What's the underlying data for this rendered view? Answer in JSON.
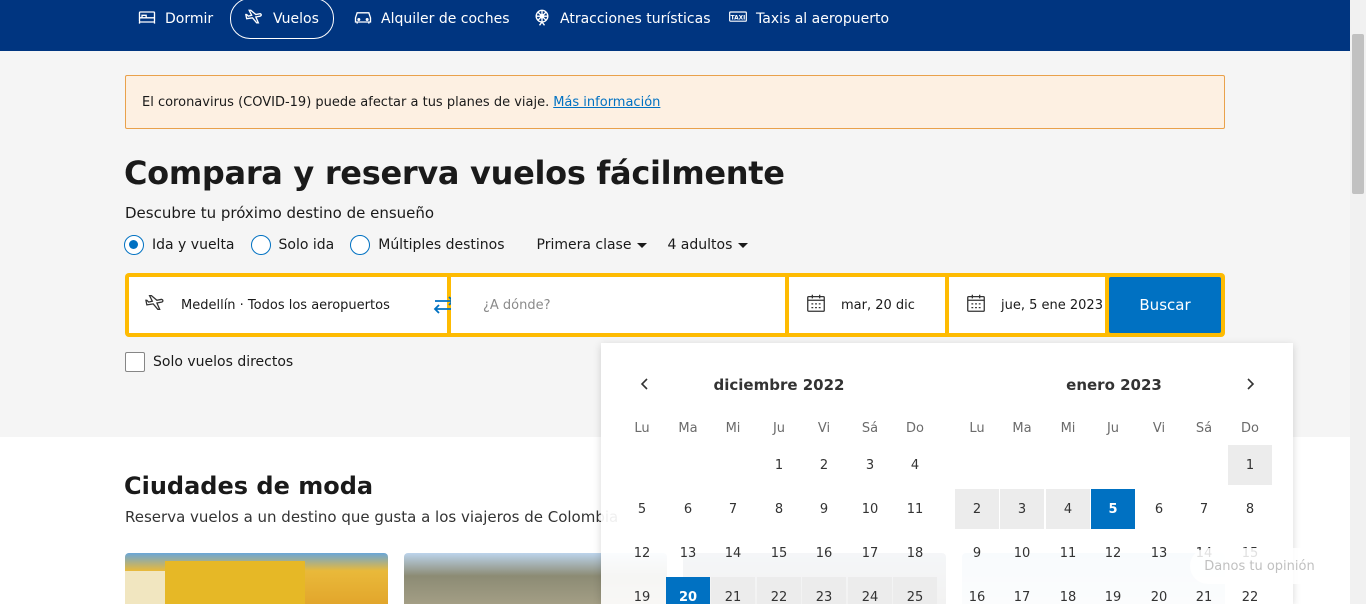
{
  "nav": {
    "items": [
      {
        "label": "Dormir",
        "icon": "bed-icon"
      },
      {
        "label": "Vuelos",
        "icon": "plane-icon"
      },
      {
        "label": "Alquiler de coches",
        "icon": "car-icon"
      },
      {
        "label": "Atracciones turísticas",
        "icon": "attractions-icon"
      },
      {
        "label": "Taxis al aeropuerto",
        "icon": "taxi-icon"
      }
    ]
  },
  "banner": {
    "text": "El coronavirus (COVID-19) puede afectar a tus planes de viaje.",
    "link": "Más información"
  },
  "hero": {
    "title": "Compara y reserva vuelos fácilmente",
    "subtitle": "Descubre tu próximo destino de ensueño"
  },
  "trip_type": {
    "options": [
      "Ida y vuelta",
      "Solo ida",
      "Múltiples destinos"
    ],
    "selected": "Ida y vuelta",
    "cabin": "Primera clase",
    "passengers": "4 adultos"
  },
  "search": {
    "origin": "Medellín · Todos los aeropuertos",
    "destination_placeholder": "¿A dónde?",
    "depart_date": "mar, 20 dic",
    "return_date": "jue, 5 ene 2023",
    "submit_label": "Buscar",
    "direct_only_label": "Solo vuelos directos"
  },
  "calendar": {
    "months": [
      "diciembre 2022",
      "enero 2023"
    ],
    "weekdays": [
      "Lu",
      "Ma",
      "Mi",
      "Ju",
      "Vi",
      "Sá",
      "Do"
    ],
    "selected_start": "20 diciembre 2022",
    "selected_end": "5 enero 2023"
  },
  "trending": {
    "title": "Ciudades de moda",
    "subtitle": "Reserva vuelos a un destino que gusta a los viajeros de Colombia"
  },
  "feedback_label": "Danos tu opinión",
  "colors": {
    "brand_blue": "#003580",
    "accent_blue": "#0071c2",
    "search_border": "#febb02",
    "banner_bg": "#fdf0e2"
  }
}
